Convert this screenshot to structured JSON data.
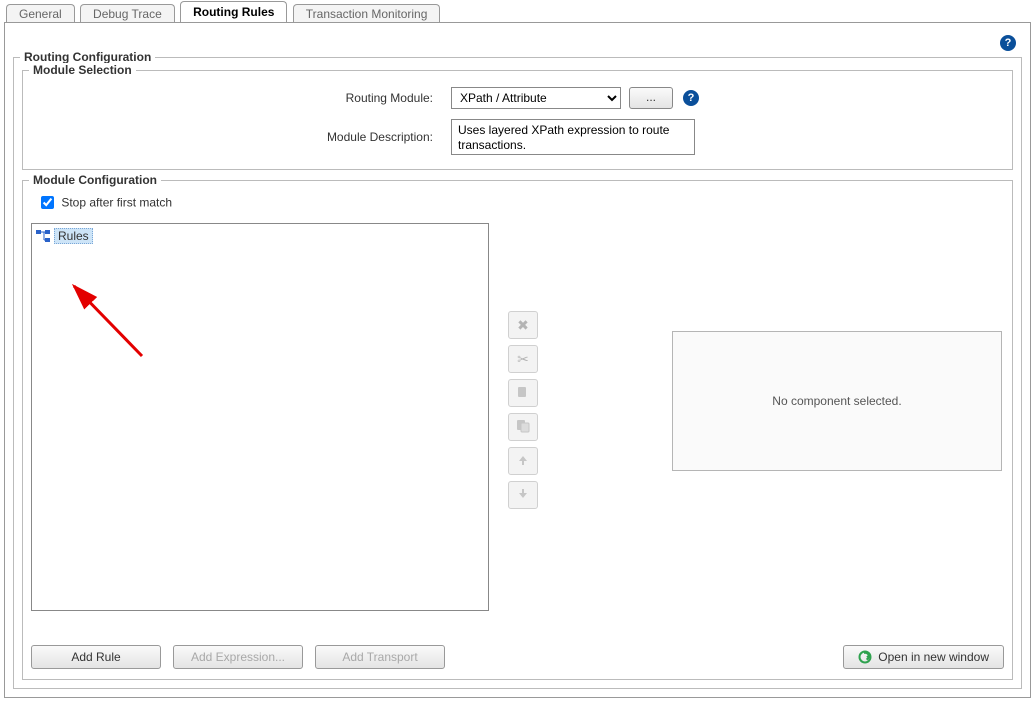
{
  "tabs": {
    "general": "General",
    "debug": "Debug Trace",
    "routing": "Routing Rules",
    "txn": "Transaction Monitoring"
  },
  "routing": {
    "legend": "Routing Configuration",
    "moduleSelection": {
      "legend": "Module Selection",
      "routingModuleLabel": "Routing Module:",
      "routingModuleValue": "XPath / Attribute",
      "ellipsis": "...",
      "descriptionLabel": "Module Description:",
      "descriptionValue": "Uses layered XPath expression to route transactions."
    },
    "moduleConfig": {
      "legend": "Module Configuration",
      "stopAfterFirstMatch": "Stop after first match",
      "stopAfterFirstMatchChecked": true,
      "tree": {
        "rootLabel": "Rules"
      },
      "rightPanel": "No component selected.",
      "toolbar": {
        "delete": "delete",
        "cut": "cut",
        "copy": "copy",
        "paste": "paste",
        "moveUp": "move up",
        "moveDown": "move down"
      }
    },
    "buttons": {
      "addRule": "Add Rule",
      "addExpression": "Add Expression...",
      "addTransport": "Add Transport",
      "openNewWindow": "Open in new window"
    }
  }
}
